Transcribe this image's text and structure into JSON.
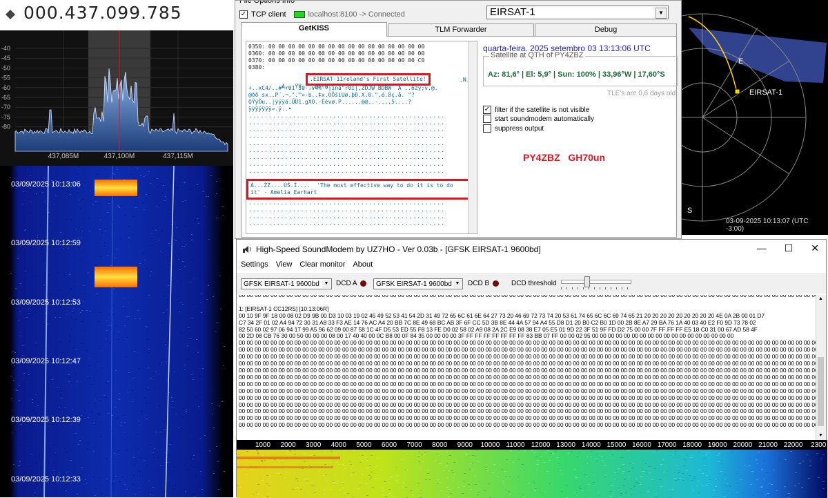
{
  "sdr": {
    "frequency": "000.437.099.785",
    "db_ticks": [
      "-40",
      "-45",
      "-50",
      "-55",
      "-60",
      "-65",
      "-70",
      "-75",
      "-80"
    ],
    "freq_ticks": [
      "437,085M",
      "437,100M",
      "437,115M"
    ],
    "waterfall_timestamps": [
      "03/09/2025 10:13:06",
      "03/09/2025 10:12:59",
      "03/09/2025 10:12:53",
      "03/09/2025 10:12:47",
      "03/09/2025 10:12:39",
      "03/09/2025 10:12:33"
    ]
  },
  "topapp": {
    "menu_fragment": "File    Options    Info",
    "tcp_label": "TCP client",
    "connection": "localhost:8100 -> Connected",
    "satellite": "EIRSAT-1",
    "tabs": [
      "GetKISS",
      "TLM Forwarder",
      "Debug"
    ],
    "hex_lines": [
      "0350: 00 00 00 00 00 00 00 00 00 00 00 00 00 00 00 00",
      "0360: 00 00 00 00 00 00 00 00 00 00 00 00 00 00 00 00",
      "0370: 00 00 00 00 00 00 00 00 00 00 00 00 00 00 00 C0",
      "0380:"
    ],
    "kiss_lines": [
      "À...ŸŸ....Ù>.Ó..",
      "+..xC4/..#\"r01¨30¨.v4%\"ª|1nâ\"r0ï|,ZDJW BDBW¨ Â¨..6zy;v.@.",
      "@ðð sx.,P¨.¬.\".™«-b..‡x.OÕšíUø.þÐ.X.0.\",é.8ç.å. \"?",
      "QÝýÕu..|ÿÿÿä.ÜÜ1.gXO.-Êèvø.P......@@..-..,,5....?",
      "ÿÿÿÿÿÿÿ».ÿ..•"
    ],
    "highlight1": ".EIRSAT-1Ireland's First Satellite!",
    "highlight1_tail": ".N.",
    "highlight2_a": "À...ŽŽ....ÙŠ.Í....  'The most effective way to do it is to do",
    "highlight2_b": "it' - Amelia Earhart",
    "datetime": "quarta-feira, 2025 setembro 03  13:13:06 UTC",
    "qth_title": "Satellite at QTH of PY4ZBZ",
    "position": "Az: 81,6° | El: 5,9° | Sun: 100% | 33,96°W | 17,60°S",
    "tle_age": "TLE's are 0,6 days old",
    "options": [
      {
        "label": "filter if the satellite is not visible",
        "checked": true
      },
      {
        "label": "start soundmodem automatically",
        "checked": false
      },
      {
        "label": "suppress output",
        "checked": false
      }
    ],
    "callsign": "PY4ZBZ   GH70un"
  },
  "polar": {
    "satellite_label": "EIRSAT-1",
    "east": "E",
    "south": "S",
    "timestamp": "03-09-2025 10:13:07 (UTC -3:00)"
  },
  "soundmodem": {
    "title": "High-Speed SoundModem by UZ7HO - Ver 0.03b - [GFSK EIRSAT-1 9600bd]",
    "menu": [
      "Settings",
      "View",
      "Clear monitor",
      "About"
    ],
    "modem_a": "GFSK EIRSAT-1 9600bd",
    "dcd_a": "DCD A",
    "modem_b": "GFSK EIRSAT-1 9600bd",
    "dcd_b": "DCD B",
    "dcd_threshold": "DCD threshold",
    "monitor_lines": [
      "00 00 00 00 00 00 00 00 00 00 00 00 00 00 00 00 00 00 00 00 00 00 00 00 00 00 00 00 00 00 00 00 00 00 00 00 00 00 00 00 00 00 00 00 00 00 00 00 00 00 00 00 00 00 00 00 00 00 00 00 00 00 00 00 00 00 00 00 00 00 00 00 00 00 00 00",
      "",
      "1: [EIRSAT-1 CC12RS] [10:13:06R]",
      "00 10 9F 9F 18 00 08 02 D9 9B 00 D3 10 03 19 02 45 49 52 53 41 54 2D 31 49 72 65 6C 61 6E 64 27 73 20 46 69 72 73 74 20 53 61 74 65 6C 6C 69 74 65 21 20 20 20 20 20 20 20 20 20 4E 0A 2B 00 01 D7",
      "C7 34 2F 01 02 A4 94 72 30 31 A8 33 F3 AE 14 76 AC A4 20 BB 7C 8E 49 68 BC AB 3F 6F CC 5D 3B 8E 44 4A 57 94 A4 55 D8 D1 20 B0 C2 B0 1D 00 2B 8E A7 29 BA 76 1A 40 03 40 E2 F0 9D 73 78 02",
      "82 50 60 02 97 06 94 17 99 A5 96 62 09 00 87 58 1C 4F D5 53 ED 55 F8 13 FE D0 02 58 02 A9 08 2A 2C E9 08 38 E7 05 E5 01 9D 22 3F 51 9F FD D2 75 00 00 7F FF FF FF E5 18 C0 31 00 67 AD 58 4F",
      "00 2D 08 CB 76 30 00 50 00 00 00 08 00 17 40 40 00 0C B8 00 0F 84 35 00 00 00 00 3F FF FF FF FF FF FF FF 83 BB 07 FF 00 00 02 95 00 00 00 00 00 00 00 00 00 00 00 00 00 00 00 00 00 00",
      "00 00 00 00 00 00 00 00 00 00 00 00 00 00 00 00 00 00 00 00 00 00 00 00 00 00 00 00 00 00 00 00 00 00 00 00 00 00 00 00 00 00 00 00 00 00 00 00 00 00 00 00 00 00 00 00 00 00 00 00 00 00 00 00 00 00 00 00 00 00 00 00 00 00 00 00",
      "00 00 00 00 00 00 00 00 00 00 00 00 00 00 00 00 00 00 00 00 00 00 00 00 00 00 00 00 00 00 00 00 00 00 00 00 00 00 00 00 00 00 00 00 00 00 00 00 00 00 00 00 00 00 00 00 00 00 00 00 00 00 00 00 00 00 00 00 00 00 00 00 00 00 00 00",
      "00 00 00 00 00 00 00 00 00 00 00 00 00 00 00 00 00 00 00 00 00 00 00 00 00 00 00 00 00 00 00 00 00 00 00 00 00 00 00 00 00 00 00 00 00 00 00 00 00 00 00 00 00 00 00 00 00 00 00 00 00 00 00 00 00 00 00 00 00 00 00 00 00 00 00 00",
      "00 00 00 00 00 00 00 00 00 00 00 00 00 00 00 00 00 00 00 00 00 00 00 00 00 00 00 00 00 00 00 00 00 00 00 00 00 00 00 00 00 00 00 00 00 00 00 00 00 00 00 00 00 00 00 00 00 00 00 00 00 00 00 00 00 00 00 00 00 00 00 00 00 00 00 00",
      "00 00 00 00 00 00 00 00 00 00 00 00 00 00 00 00 00 00 00 00 00 00 00 00 00 00 00 00 00 00 00 00 00 00 00 00 00 00 00 00 00 00 00 00 00 00 00 00 00 00 00 00 00 00 00 00 00 00 00 00 00 00 00 00 00 00 00 00 00 00 00 00 00 00 00 00",
      "00 00 00 00 00 00 00 00 00 00 00 00 00 00 00 00 00 00 00 00 00 00 00 00 00 00 00 00 00 00 00 00 00 00 00 00 00 00 00 00 00 00 00 00 00 00 00 00 00 00 00 00 00 00 00 00 00 00 00 00 00 00 00 00 00 00 00 00 00 00 00 00 00 00 00 00",
      "00 00 00 00 00 00 00 00 00 00 00 00 00 00 00 00 00 00 00 00 00 00 00 00 00 00 00 00 00 00 00 00 00 00 00 00 00 00 00 00 00 00 00 00 00 00 00 00 00 00 00 00 00 00 00 00 00 00 00 00 00 00 00 00 00 00 00 00 00 00 00 00 00 00 00 00",
      "00 00 00 00 00 00 00 00 00 00 00 00 00 00 00 00 00 00 00 00 00 00 00 00 00 00 00 00 00 00 00 00 00 00 00 00 00 00 00 00 00 00 00 00 00 00 00 00 00 00 00 00 00 00 00 00 00 00 00 00 00 00 00 00 00 00 00 00 00 00 00 00 00 00 00 00",
      "00 00 00 00 00 00 00 00 00 00 00 00 00 00 00 00 00 00 00 00 00 00 00 00 00 00 00 00 00 00 00 00 00 00 00 00 00 00 00 00 00 00 00 00 00 00 00 00 00 00 00 00 00 00 00 00 00 00 00 00 00 00 00 00 00 00 00 00 00 00 00 00 00 00 00 00",
      "00 00 00 00 00 00 00 00 00 00 00 00 00 00 00 00 00 00 00 00 00 00 00 00 00 00 00 00 00 00 00 00 00 00 00 00 00 00 00 00 00 00 00 00 00 00 00 00 00 00 00 00 00 00 00 00 00 00 00 00 00 00 00 00 00 00 00 00 00 00 00 00 00 00 00 00",
      "00 00 00 00 00 00 00 00 00 00 00 00 00 00 00 00 00 00 00 00 00 00 00 00 00 00 00 00 00 00 00 00 00 00 00 00 00 00 00 00 00 00 00 00 00 00 00 00 00 00 00 00 00 00 00 00 00 00 00 00 00 00 00 00 00 00 00 00 00 00 00 00 00 00 00 00",
      "00 00 00 00 00 00 00 00 00 00 00 00 00 00 00 00 00 00 00 00 00 00 00 00 00 00 00 00 00 00 00 00 00 00 00 00 00 00 00 00 00 00 00 00 00 00 00 00 00 00 00 00 00 00 00 00 00 00 00 00 00 00 00 00 00 00 00 00 00 00 00 00 00 00 00 00",
      "00 00 00 00 00 00 00 00 00 00 00 00 00 00 00 00 00 00 00 00 00 00 00 00 00 00 00 00 00 00 00 00 00 00 00 00 00 00 00 00 00 00 00 00 00 00 00 00 00 00 00 00 00 00 00 00 00 00 00 00 00 00 00 00 00 00 00 00 00 00 00 00 00 00 00 00"
    ],
    "ruler_ticks": [
      "1000",
      "2000",
      "3000",
      "4000",
      "5000",
      "6000",
      "7000",
      "8000",
      "9000",
      "10000",
      "11000",
      "12000",
      "13000",
      "14000",
      "15000",
      "16000",
      "17000",
      "18000",
      "19000",
      "20000",
      "21000",
      "22000",
      "2300"
    ]
  },
  "colors": {
    "highlight_red": "#e0141e",
    "led_green": "#2bd12b",
    "datetime_blue": "#2222cc",
    "position_green": "#1a6b3a"
  }
}
